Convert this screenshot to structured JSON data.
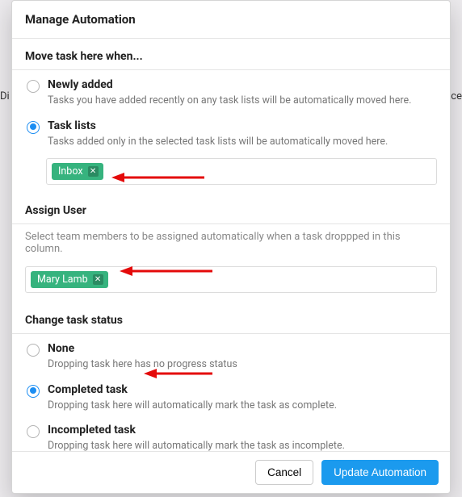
{
  "modal": {
    "title": "Manage Automation",
    "move_section": {
      "title": "Move task here when...",
      "options": {
        "newly_added": {
          "label": "Newly added",
          "desc": "Tasks you have added recently on any task lists will be automatically moved here."
        },
        "task_lists": {
          "label": "Task lists",
          "desc": "Tasks added only in the selected task lists will be automatically moved here.",
          "tags": [
            "Inbox"
          ]
        }
      },
      "selected": "task_lists"
    },
    "assign_section": {
      "title": "Assign User",
      "desc": "Select team members to be assigned automatically when a task droppped in this column.",
      "tags": [
        "Mary Lamb"
      ]
    },
    "status_section": {
      "title": "Change task status",
      "options": {
        "none": {
          "label": "None",
          "desc": "Dropping task here has no progress status"
        },
        "completed": {
          "label": "Completed task",
          "desc": "Dropping task here will automatically mark the task as complete."
        },
        "incompleted": {
          "label": "Incompleted task",
          "desc": "Dropping task here will automatically mark the task as incomplete."
        }
      },
      "selected": "completed"
    },
    "footer": {
      "cancel": "Cancel",
      "submit": "Update Automation"
    }
  },
  "background": {
    "left_fragment": "Di",
    "right_fragment": "ce"
  }
}
